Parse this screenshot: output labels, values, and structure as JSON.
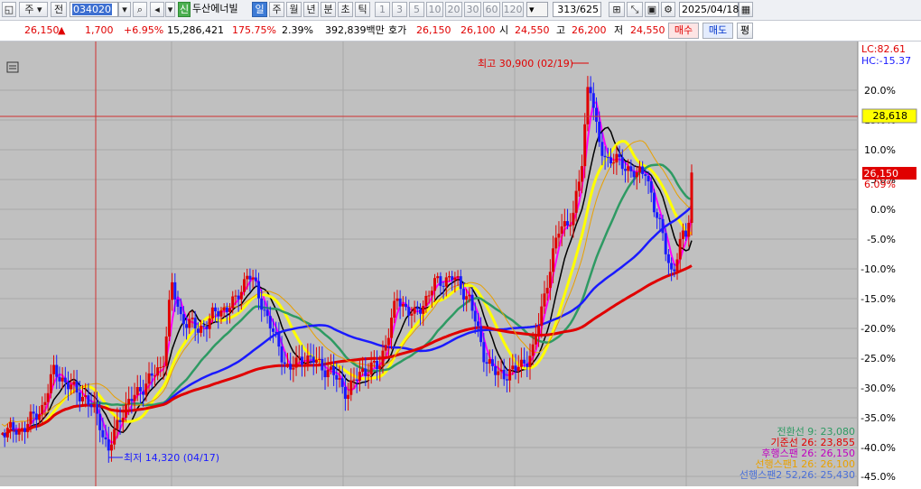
{
  "toolbar": {
    "market": "주",
    "mode": "전",
    "code": "034020",
    "name": "두산에너빌",
    "badge": "신",
    "periods": [
      "일",
      "주",
      "월",
      "년",
      "분",
      "초",
      "틱"
    ],
    "active_period": "일",
    "intervals": [
      "1",
      "3",
      "5",
      "10",
      "20",
      "30",
      "60",
      "120"
    ],
    "count": "313",
    "total": "/625",
    "date": "2025/04/18"
  },
  "info": {
    "price": "26,150",
    "change": "1,700",
    "change_pct": "+6.95%",
    "volume": "15,286,421",
    "vol_ratio": "175.75%",
    "turnover": "2.39%",
    "amount": "392,839백만",
    "quote_label": "호가",
    "ask": "26,150",
    "bid": "26,100",
    "open_label": "시",
    "open": "24,550",
    "high_label": "고",
    "high": "26,200",
    "low_label": "저",
    "low": "24,550",
    "buy": "매수",
    "sell": "매도",
    "eval": "평"
  },
  "chart": {
    "lc": "LC:82.61",
    "hc": "HC:-15.37",
    "y_ticks": [
      "20.0%",
      "15.0%",
      "10.0%",
      "5.0%",
      "0.0%",
      "-5.0%",
      "-10.0%",
      "-15.0%",
      "-20.0%",
      "-25.0%",
      "-30.0%",
      "-35.0%",
      "-40.0%",
      "-45.0%"
    ],
    "crosshair_value": "28,618",
    "current_price": "26,150",
    "current_pct": "6.09%",
    "high_note": "최고 30,900 (02/19)",
    "low_note": "최저 14,320 (04/17)",
    "legend": [
      {
        "text": "전환선 9: 23,080",
        "color": "#2e9a63"
      },
      {
        "text": "기준선 26: 23,855",
        "color": "#e00000"
      },
      {
        "text": "후행스팬 26: 26,150",
        "color": "#c000c0"
      },
      {
        "text": "선행스팬1 26: 26,100",
        "color": "#e8a000"
      },
      {
        "text": "선행스팬2 52,26: 25,430",
        "color": "#4a6fd8"
      }
    ],
    "colors": {
      "up": "#e00000",
      "down": "#1a1aff",
      "bg": "#c0c0c0"
    }
  }
}
